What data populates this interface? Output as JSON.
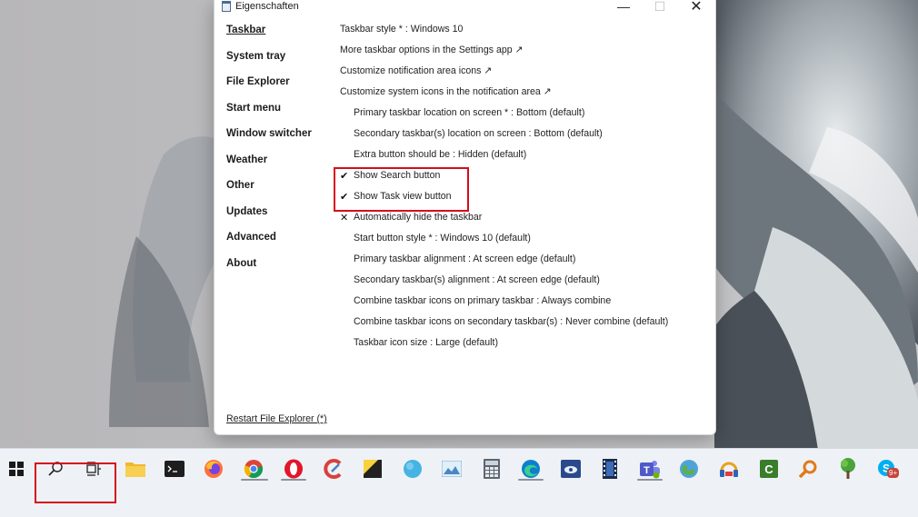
{
  "window": {
    "title": "Eigenschaften",
    "controls": {
      "minimize": "—",
      "maximize": "☐",
      "close": "✕"
    }
  },
  "nav": {
    "items": [
      {
        "label": "Taskbar",
        "active": true
      },
      {
        "label": "System tray",
        "active": false
      },
      {
        "label": "File Explorer",
        "active": false
      },
      {
        "label": "Start menu",
        "active": false
      },
      {
        "label": "Window switcher",
        "active": false
      },
      {
        "label": "Weather",
        "active": false
      },
      {
        "label": "Other",
        "active": false
      },
      {
        "label": "Updates",
        "active": false
      },
      {
        "label": "Advanced",
        "active": false
      },
      {
        "label": "About",
        "active": false
      }
    ]
  },
  "options": {
    "taskbar_style": "Taskbar style * : Windows 10",
    "more_options": "More taskbar options in the Settings app ↗",
    "customize_notification": "Customize notification area icons ↗",
    "customize_system_icons": "Customize system icons in the notification area ↗",
    "primary_location": "Primary taskbar location on screen * : Bottom (default)",
    "secondary_location": "Secondary taskbar(s) location on screen : Bottom (default)",
    "extra_button": "Extra button should be : Hidden (default)",
    "show_search": "Show Search button",
    "show_task_view": "Show Task view button",
    "auto_hide": "Automatically hide the taskbar",
    "start_button_style": "Start button style * : Windows 10 (default)",
    "primary_alignment": "Primary taskbar alignment : At screen edge (default)",
    "secondary_alignment": "Secondary taskbar(s) alignment : At screen edge (default)",
    "combine_primary": "Combine taskbar icons on primary taskbar : Always combine",
    "combine_secondary": "Combine taskbar icons on secondary taskbar(s) : Never combine (default)",
    "icon_size": "Taskbar icon size : Large (default)"
  },
  "marks": {
    "show_search": "✔",
    "show_task_view": "✔",
    "auto_hide": "✕"
  },
  "restart_link": "Restart File Explorer (*)",
  "taskbar": {
    "icons": [
      "start-icon",
      "search-icon",
      "task-view-icon",
      "file-explorer-icon",
      "terminal-icon",
      "firefox-icon",
      "chrome-icon",
      "opera-icon",
      "ccleaner-icon",
      "sticky-notes-icon",
      "app-icon",
      "photos-icon",
      "calculator-icon",
      "edge-icon",
      "image-viewer-icon",
      "video-editor-icon",
      "teams-icon",
      "maps-icon",
      "headset-app-icon",
      "camtasia-icon",
      "search-tool-icon",
      "tree-icon",
      "skype-icon"
    ],
    "skype_badge": "9+"
  },
  "colors": {
    "highlight_red": "#d60c1c",
    "taskbar_bg": "#eef2f6"
  }
}
